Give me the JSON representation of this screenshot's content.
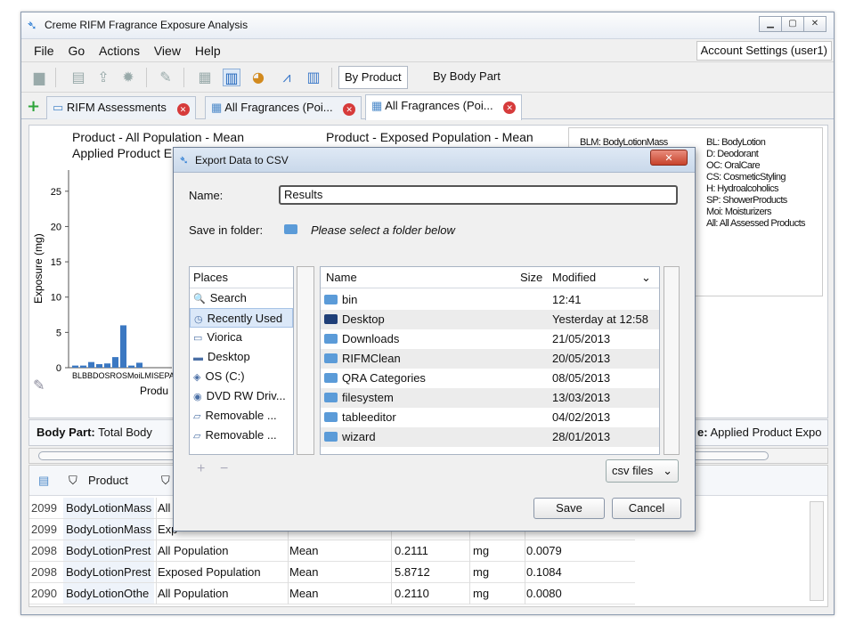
{
  "window": {
    "title": "Creme RIFM Fragrance Exposure Analysis"
  },
  "menu": {
    "items": [
      "File",
      "Go",
      "Actions",
      "View",
      "Help"
    ],
    "account": "Account Settings (user1)"
  },
  "toolbar": {
    "by_product": "By Product",
    "by_body_part": "By Body Part"
  },
  "tabs": [
    {
      "label": "RIFM Assessments"
    },
    {
      "label": "All Fragrances (Poi..."
    },
    {
      "label": "All Fragrances (Poi..."
    }
  ],
  "chart1": {
    "title_line1": "Product - All Population - Mean",
    "title_line2": "Applied Product E",
    "ylabel": "Exposure (mg)",
    "xlabel": "Produ",
    "xticks_text": "BLBBDOSROSMoiLMISEPAS"
  },
  "chart2": {
    "title_line1": "Product - Exposed Population - Mean"
  },
  "chart_data": {
    "type": "bar",
    "title": "Product - All Population - Mean",
    "ylabel": "Exposure (mg)",
    "yticks": [
      0,
      5,
      10,
      15,
      20,
      25
    ],
    "ylim": [
      0,
      28
    ],
    "values": [
      0.3,
      0.3,
      0.8,
      0.5,
      0.6,
      1.5,
      6.0,
      0.3,
      0.7
    ]
  },
  "legend": {
    "col1": [
      "BLM: BodyLotionMass"
    ],
    "col2": [
      "BL: BodyLotion",
      "D: Deodorant",
      "OC: OralCare",
      "CS: CosmeticStyling",
      "H: Hydroalcoholics",
      "SP: ShowerProducts",
      "Moi: Moisturizers",
      "All: All Assessed Products"
    ]
  },
  "infobar": {
    "left_bold": "Body Part:",
    "left_value": "Total Body",
    "right_bold": "e:",
    "right_value": "Applied Product Expo"
  },
  "grid": {
    "head_product": "Product",
    "rows": [
      [
        "2099",
        "BodyLotionMass",
        "All",
        "",
        "",
        "",
        ""
      ],
      [
        "2099",
        "BodyLotionMass",
        "Exp",
        "",
        "",
        "",
        ""
      ],
      [
        "2098",
        "BodyLotionPrest",
        "All Population",
        "Mean",
        "0.2111",
        "mg",
        "0.0079"
      ],
      [
        "2098",
        "BodyLotionPrest",
        "Exposed Population",
        "Mean",
        "5.8712",
        "mg",
        "0.1084"
      ],
      [
        "2090",
        "BodyLotionOthe",
        "All Population",
        "Mean",
        "0.2110",
        "mg",
        "0.0080"
      ]
    ]
  },
  "dialog": {
    "title": "Export Data to CSV",
    "name_label": "Name:",
    "name_value": "Results",
    "folder_label": "Save in folder:",
    "folder_hint": "Please select a folder below",
    "places_header": "Places",
    "places": [
      "Search",
      "Recently Used",
      "Viorica",
      "Desktop",
      "OS (C:)",
      "DVD RW Driv...",
      "Removable ...",
      "Removable ..."
    ],
    "files_header": {
      "name": "Name",
      "size": "Size",
      "modified": "Modified"
    },
    "files": [
      {
        "name": "bin",
        "modified": "12:41"
      },
      {
        "name": "Desktop",
        "modified": "Yesterday at 12:58"
      },
      {
        "name": "Downloads",
        "modified": "21/05/2013"
      },
      {
        "name": "RIFMClean",
        "modified": "20/05/2013"
      },
      {
        "name": "QRA Categories",
        "modified": "08/05/2013"
      },
      {
        "name": "filesystem",
        "modified": "13/03/2013"
      },
      {
        "name": "tableeditor",
        "modified": "04/02/2013"
      },
      {
        "name": "wizard",
        "modified": "28/01/2013"
      }
    ],
    "filter": "csv files",
    "save": "Save",
    "cancel": "Cancel"
  }
}
